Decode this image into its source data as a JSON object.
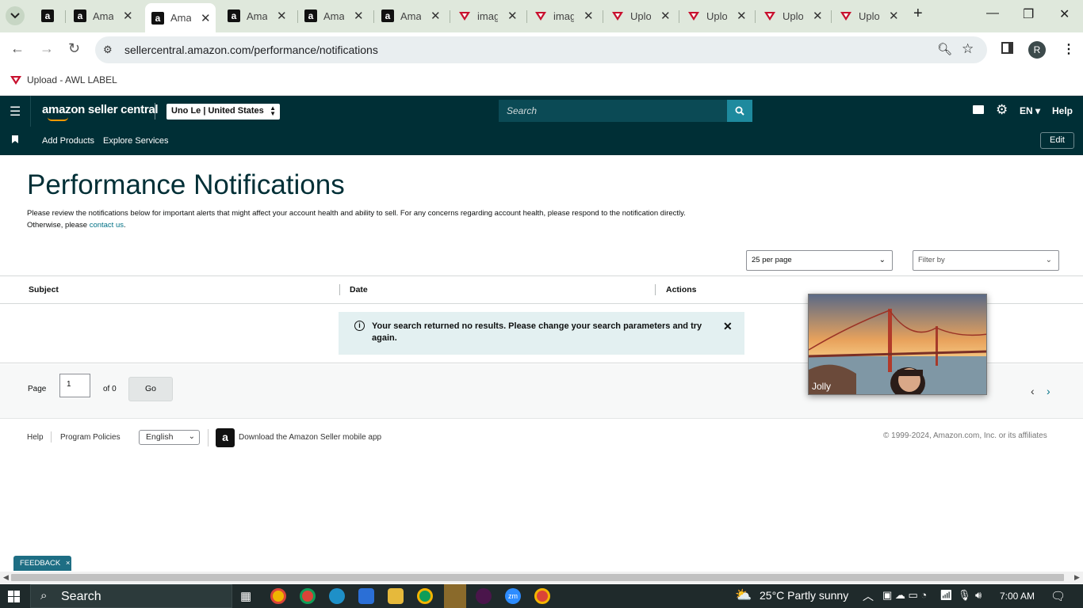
{
  "browser": {
    "tabs": [
      {
        "label": "",
        "icon": "amazon-icon"
      },
      {
        "label": "Ama",
        "icon": "amazon-icon"
      },
      {
        "label": "Ama",
        "icon": "amazon-icon",
        "active": true
      },
      {
        "label": "Ama",
        "icon": "amazon-icon"
      },
      {
        "label": "Ama",
        "icon": "amazon-icon"
      },
      {
        "label": "Ama",
        "icon": "amazon-icon"
      },
      {
        "label": "imag",
        "icon": "awl-icon"
      },
      {
        "label": "imag",
        "icon": "awl-icon"
      },
      {
        "label": "Uplo",
        "icon": "awl-icon"
      },
      {
        "label": "Uplo",
        "icon": "awl-icon"
      },
      {
        "label": "Uplo",
        "icon": "awl-icon"
      },
      {
        "label": "Uplo",
        "icon": "awl-icon"
      }
    ],
    "url": "sellercentral.amazon.com/performance/notifications",
    "profile_initial": "R",
    "bookmark_label": "Upload - AWL LABEL"
  },
  "header": {
    "logo_text": "amazon seller central",
    "marketplace": "Uno Le | United States",
    "search_placeholder": "Search",
    "language": "EN",
    "help": "Help",
    "nav_items": [
      "Add Products",
      "Explore Services"
    ],
    "edit": "Edit"
  },
  "page": {
    "title": "Performance Notifications",
    "description": "Please review the notifications below for important alerts that might affect your account health and ability to sell. For any concerns regarding account health, please respond to the notification directly. Otherwise, please",
    "contact_link": "contact us",
    "per_page": "25 per page",
    "filter_placeholder": "Filter by",
    "columns": [
      "Subject",
      "Date",
      "Actions"
    ],
    "alert_text": "Your search returned no results. Please change your search parameters and try again.",
    "pager": {
      "page_label": "Page",
      "page_value": "1",
      "of_label": "of 0",
      "go": "Go"
    }
  },
  "footer": {
    "links": [
      "Help",
      "Program Policies"
    ],
    "language": "English",
    "app_text": "Download the Amazon Seller mobile app",
    "copyright": "© 1999-2024, Amazon.com, Inc. or its affiliates",
    "feedback": "FEEDBACK"
  },
  "video": {
    "name": "Jolly"
  },
  "taskbar": {
    "search": "Search",
    "weather": "25°C  Partly sunny",
    "time": "7:00 AM"
  },
  "colors": {
    "header_bg": "#002f36",
    "link": "#007185",
    "alert_bg": "#e3f0f1"
  }
}
